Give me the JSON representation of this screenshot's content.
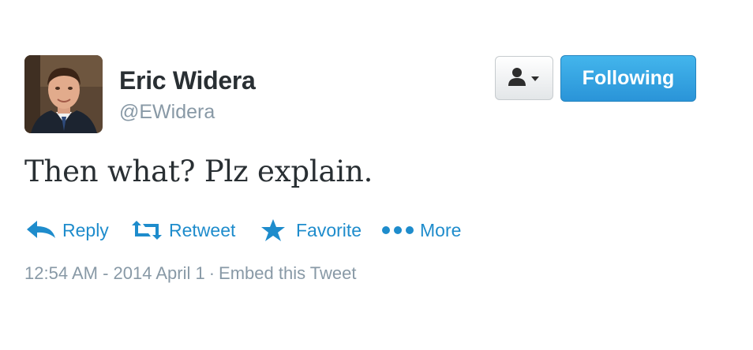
{
  "user": {
    "display_name": "Eric Widera",
    "screen_name": "@EWidera",
    "avatar_icon": "profile-photo"
  },
  "header": {
    "user_actions_icon": "person-dropdown-icon",
    "follow_label": "Following",
    "follow_color": "#2a94d8"
  },
  "tweet": {
    "text": "Then what? Plz explain."
  },
  "actions": {
    "reply": {
      "label": "Reply",
      "icon": "reply-arrow-icon"
    },
    "retweet": {
      "label": "Retweet",
      "icon": "retweet-icon"
    },
    "favorite": {
      "label": "Favorite",
      "icon": "star-icon"
    },
    "more": {
      "label": "More",
      "icon": "ellipsis-icon"
    },
    "link_color": "#1e8ccc"
  },
  "meta": {
    "timestamp": "12:54 AM - 2014 April 1",
    "separator": "·",
    "embed_label": "Embed this Tweet"
  }
}
